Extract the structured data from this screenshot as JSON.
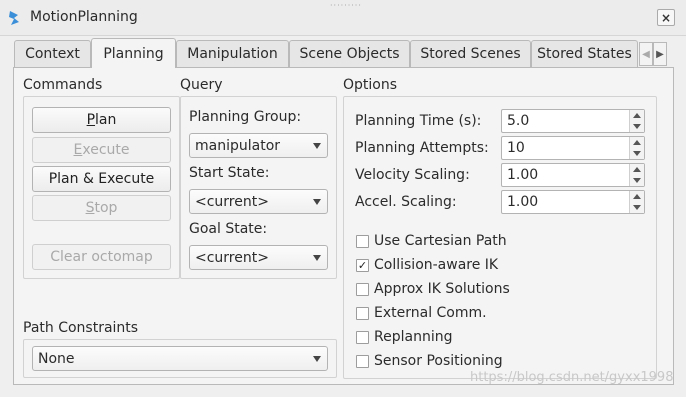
{
  "window": {
    "title": "MotionPlanning",
    "close_label": "×"
  },
  "tabs": [
    {
      "label": "Context"
    },
    {
      "label": "Planning"
    },
    {
      "label": "Manipulation"
    },
    {
      "label": "Scene Objects"
    },
    {
      "label": "Stored Scenes"
    },
    {
      "label": "Stored States"
    }
  ],
  "commands": {
    "title": "Commands",
    "plan": "Plan",
    "execute": "Execute",
    "plan_execute": "Plan & Execute",
    "stop": "Stop",
    "clear_octomap": "Clear octomap"
  },
  "query": {
    "title": "Query",
    "planning_group_label": "Planning Group:",
    "planning_group_value": "manipulator",
    "start_state_label": "Start State:",
    "start_state_value": "<current>",
    "goal_state_label": "Goal State:",
    "goal_state_value": "<current>"
  },
  "options": {
    "title": "Options",
    "planning_time_label": "Planning Time (s):",
    "planning_time_value": "5.0",
    "planning_attempts_label": "Planning Attempts:",
    "planning_attempts_value": "10",
    "velocity_scaling_label": "Velocity Scaling:",
    "velocity_scaling_value": "1.00",
    "accel_scaling_label": "Accel. Scaling:",
    "accel_scaling_value": "1.00",
    "checkboxes": [
      {
        "label": "Use Cartesian Path",
        "checked": false
      },
      {
        "label": "Collision-aware IK",
        "checked": true
      },
      {
        "label": "Approx IK Solutions",
        "checked": false
      },
      {
        "label": "External Comm.",
        "checked": false
      },
      {
        "label": "Replanning",
        "checked": false
      },
      {
        "label": "Sensor Positioning",
        "checked": false
      }
    ]
  },
  "path_constraints": {
    "title": "Path Constraints",
    "value": "None"
  },
  "watermark": "https://blog.csdn.net/gyxx1998"
}
